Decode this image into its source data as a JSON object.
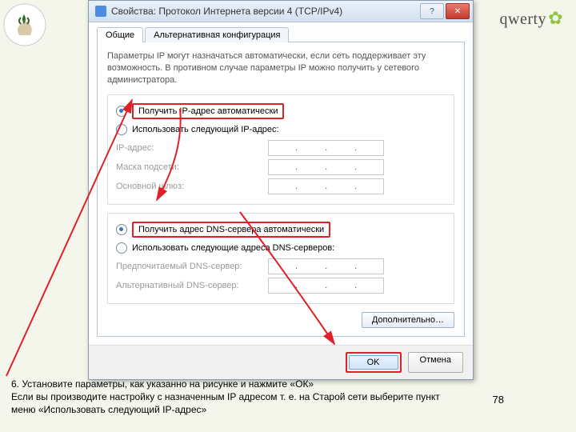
{
  "dialog": {
    "title": "Свойства: Протокол Интернета версии 4 (TCP/IPv4)",
    "tabs": {
      "general": "Общие",
      "alt": "Альтернативная конфигурация"
    },
    "intro": "Параметры IP могут назначаться автоматически, если сеть поддерживает эту возможность. В противном случае параметры IP можно получить у сетевого администратора.",
    "ip": {
      "auto": "Получить IP-адрес автоматически",
      "manual": "Использовать следующий IP-адрес:",
      "addr": "IP-адрес:",
      "mask": "Маска подсети:",
      "gw": "Основной шлюз:"
    },
    "dns": {
      "auto": "Получить адрес DNS-сервера автоматически",
      "manual": "Использовать следующие адреса DNS-серверов:",
      "pref": "Предпочитаемый DNS-сервер:",
      "alt": "Альтернативный DNS-сервер:"
    },
    "advanced": "Дополнительно…",
    "ok": "OK",
    "cancel": "Отмена"
  },
  "brand": "qwerty",
  "instruction": {
    "l1": "6. Установите параметры, как указанно на рисунке и нажмите «ОК»",
    "l2": "Если вы производите  настройку с назначенным IP адресом т. е. на Старой сети выберите пункт меню «Использовать следующий IP-адрес»"
  },
  "page": "78"
}
